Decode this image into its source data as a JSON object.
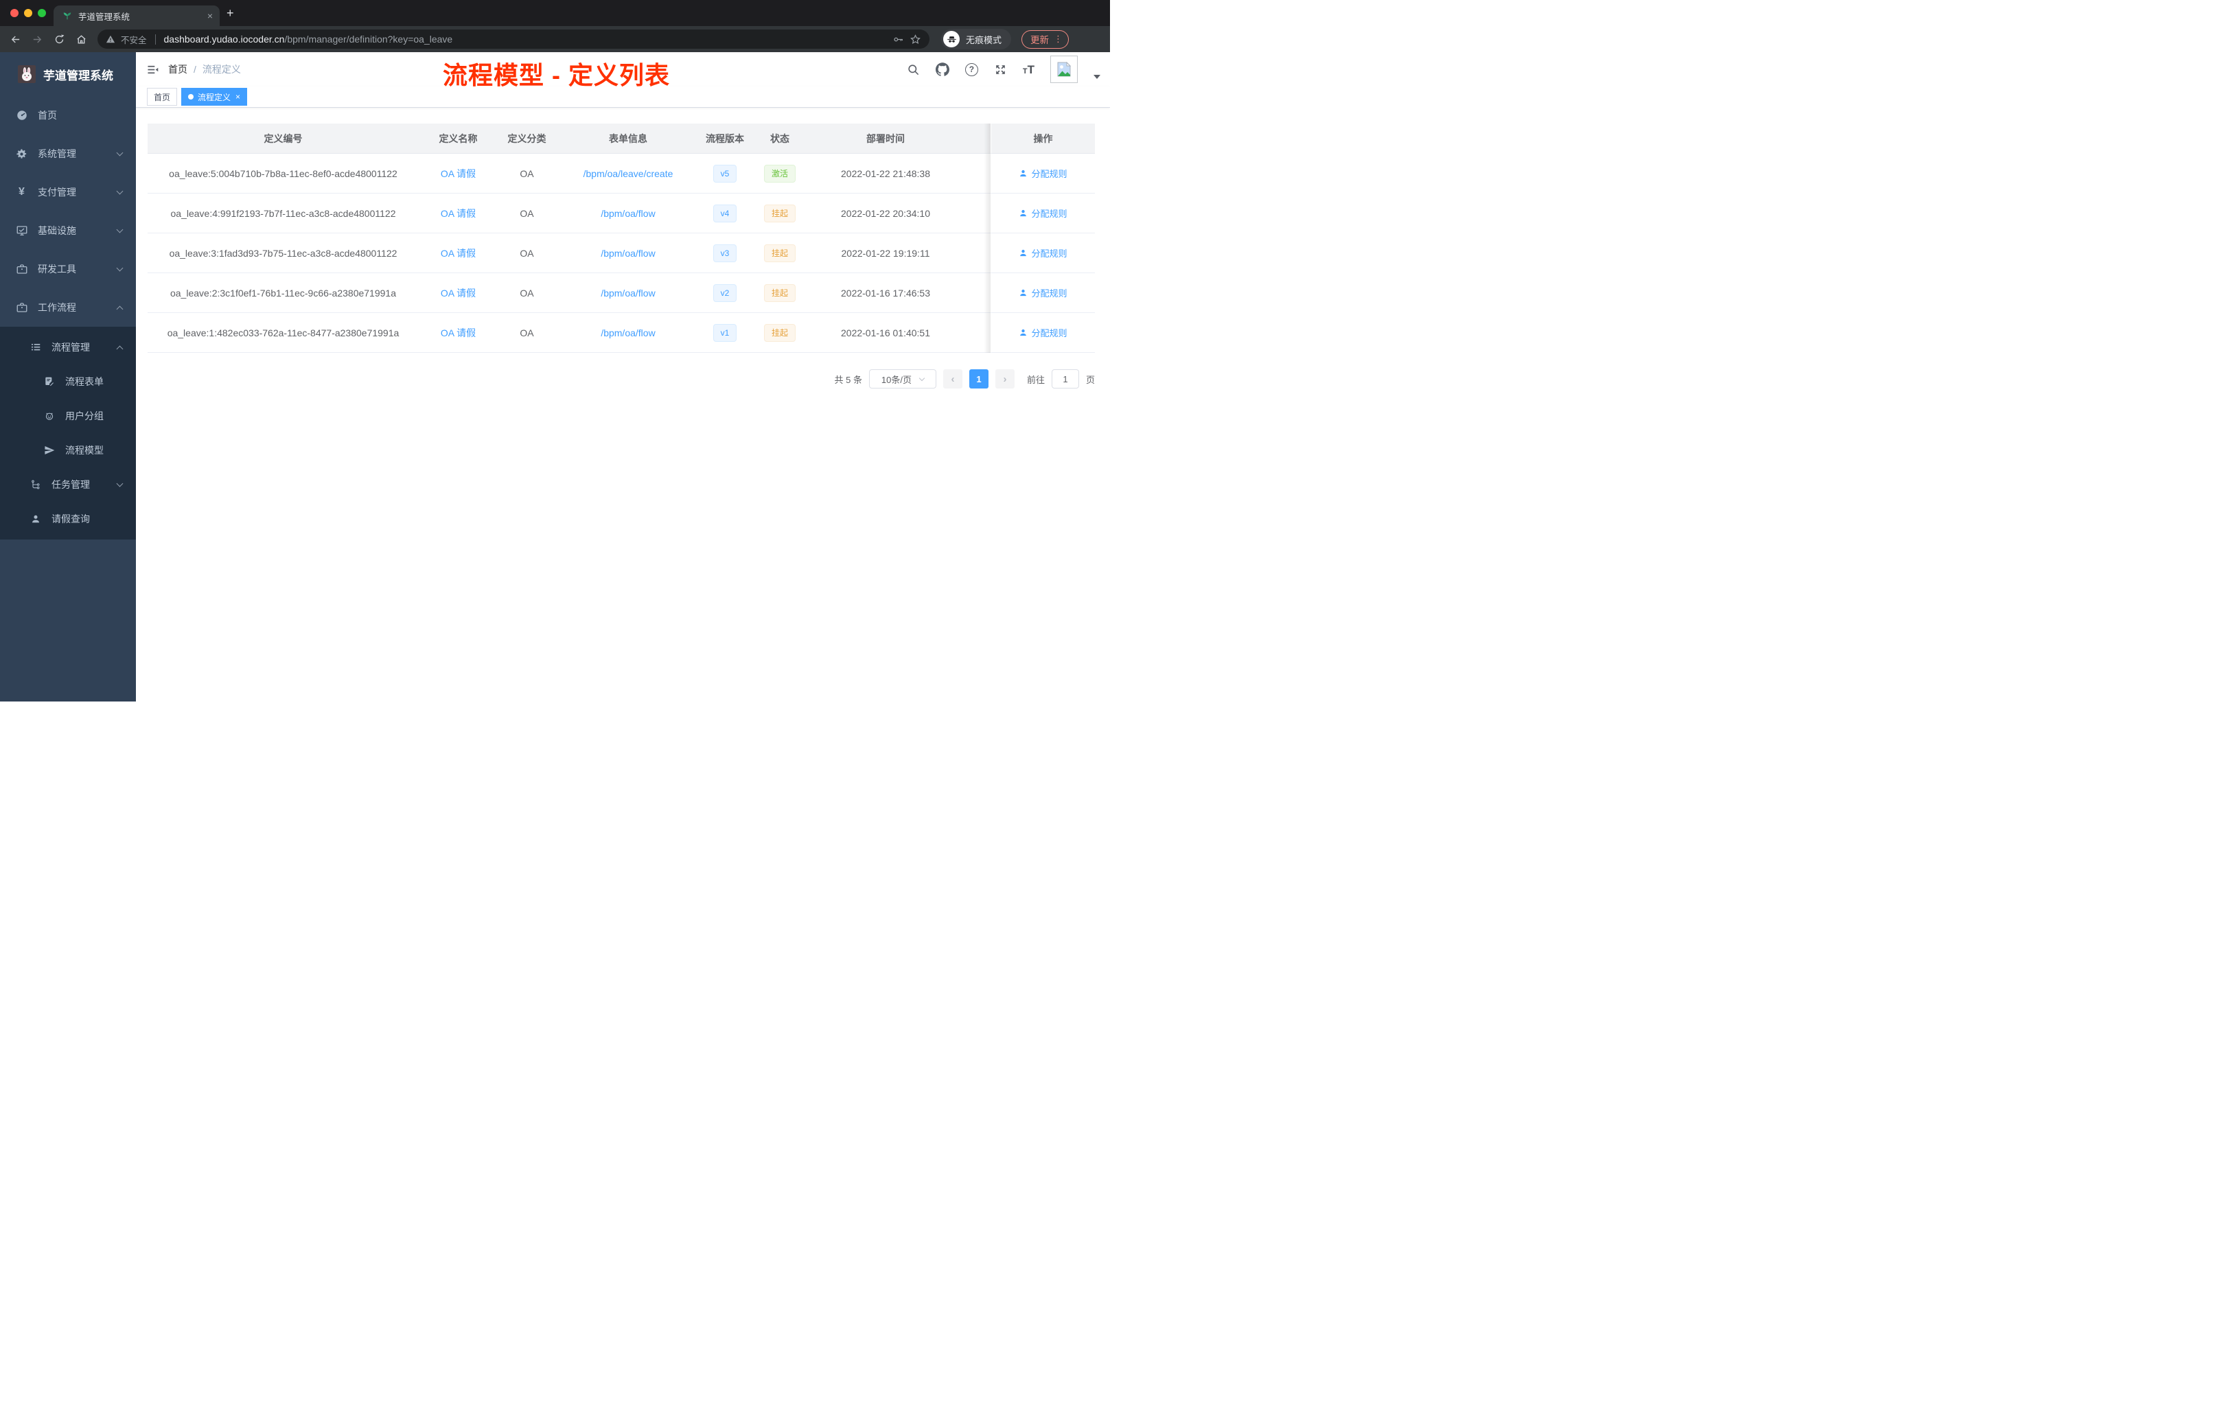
{
  "colors": {
    "accent": "#409eff",
    "annotation_red": "#ff3100",
    "sidebar_bg": "#304156",
    "submenu_bg": "#1f2d3d",
    "success_green": "#67c23a",
    "warning_orange": "#e6a23c",
    "update_red": "#f28b82",
    "active_tag_blue": "#409eff"
  },
  "browser": {
    "tab_title": "芋道管理系统",
    "close_tab": "×",
    "new_tab": "+",
    "security_label": "不安全",
    "url_domain": "dashboard.yudao.iocoder.cn",
    "url_path": "/bpm/manager/definition?key=oa_leave",
    "incognito_label": "无痕模式",
    "update_label": "更新",
    "menu_dots": "⋮"
  },
  "sidebar": {
    "logo_title": "芋道管理系统",
    "items": [
      {
        "label": "首页",
        "icon": "dashboard-icon"
      },
      {
        "label": "系统管理",
        "icon": "gear-icon",
        "expand": "down"
      },
      {
        "label": "支付管理",
        "icon": "yen-icon",
        "expand": "down"
      },
      {
        "label": "基础设施",
        "icon": "monitor-icon",
        "expand": "down"
      },
      {
        "label": "研发工具",
        "icon": "briefcase-icon",
        "expand": "down"
      },
      {
        "label": "工作流程",
        "icon": "briefcase-icon",
        "expand": "up"
      }
    ],
    "submenu": [
      {
        "label": "流程管理",
        "icon": "list-icon",
        "expand": "up"
      },
      {
        "label": "流程表单",
        "icon": "form-icon"
      },
      {
        "label": "用户分组",
        "icon": "group-icon"
      },
      {
        "label": "流程模型",
        "icon": "send-icon"
      },
      {
        "label": "任务管理",
        "icon": "tree-icon",
        "expand": "down"
      },
      {
        "label": "请假查询",
        "icon": "user-icon"
      }
    ]
  },
  "navbar": {
    "breadcrumb_home": "首页",
    "breadcrumb_sep": "/",
    "breadcrumb_current": "流程定义"
  },
  "annotation": {
    "text": "流程模型 - 定义列表"
  },
  "tags": {
    "home": "首页",
    "active": "流程定义",
    "close": "×"
  },
  "table": {
    "columns": [
      "定义编号",
      "定义名称",
      "定义分类",
      "表单信息",
      "流程版本",
      "状态",
      "部署时间",
      "操作"
    ],
    "rows": [
      {
        "id": "oa_leave:5:004b710b-7b8a-11ec-8ef0-acde48001122",
        "name": "OA 请假",
        "category": "OA",
        "form": "/bpm/oa/leave/create",
        "version": "v5",
        "status": "激活",
        "time": "2022-01-22 21:48:38",
        "action": "分配规则"
      },
      {
        "id": "oa_leave:4:991f2193-7b7f-11ec-a3c8-acde48001122",
        "name": "OA 请假",
        "category": "OA",
        "form": "/bpm/oa/flow",
        "version": "v4",
        "status": "挂起",
        "time": "2022-01-22 20:34:10",
        "action": "分配规则"
      },
      {
        "id": "oa_leave:3:1fad3d93-7b75-11ec-a3c8-acde48001122",
        "name": "OA 请假",
        "category": "OA",
        "form": "/bpm/oa/flow",
        "version": "v3",
        "status": "挂起",
        "time": "2022-01-22 19:19:11",
        "action": "分配规则"
      },
      {
        "id": "oa_leave:2:3c1f0ef1-76b1-11ec-9c66-a2380e71991a",
        "name": "OA 请假",
        "category": "OA",
        "form": "/bpm/oa/flow",
        "version": "v2",
        "status": "挂起",
        "time": "2022-01-16 17:46:53",
        "action": "分配规则"
      },
      {
        "id": "oa_leave:1:482ec033-762a-11ec-8477-a2380e71991a",
        "name": "OA 请假",
        "category": "OA",
        "form": "/bpm/oa/flow",
        "version": "v1",
        "status": "挂起",
        "time": "2022-01-16 01:40:51",
        "action": "分配规则"
      }
    ]
  },
  "pagination": {
    "total": "共 5 条",
    "page_size": "10条/页",
    "prev": "‹",
    "next": "›",
    "page": "1",
    "goto_label": "前往",
    "goto_value": "1",
    "goto_unit": "页"
  }
}
